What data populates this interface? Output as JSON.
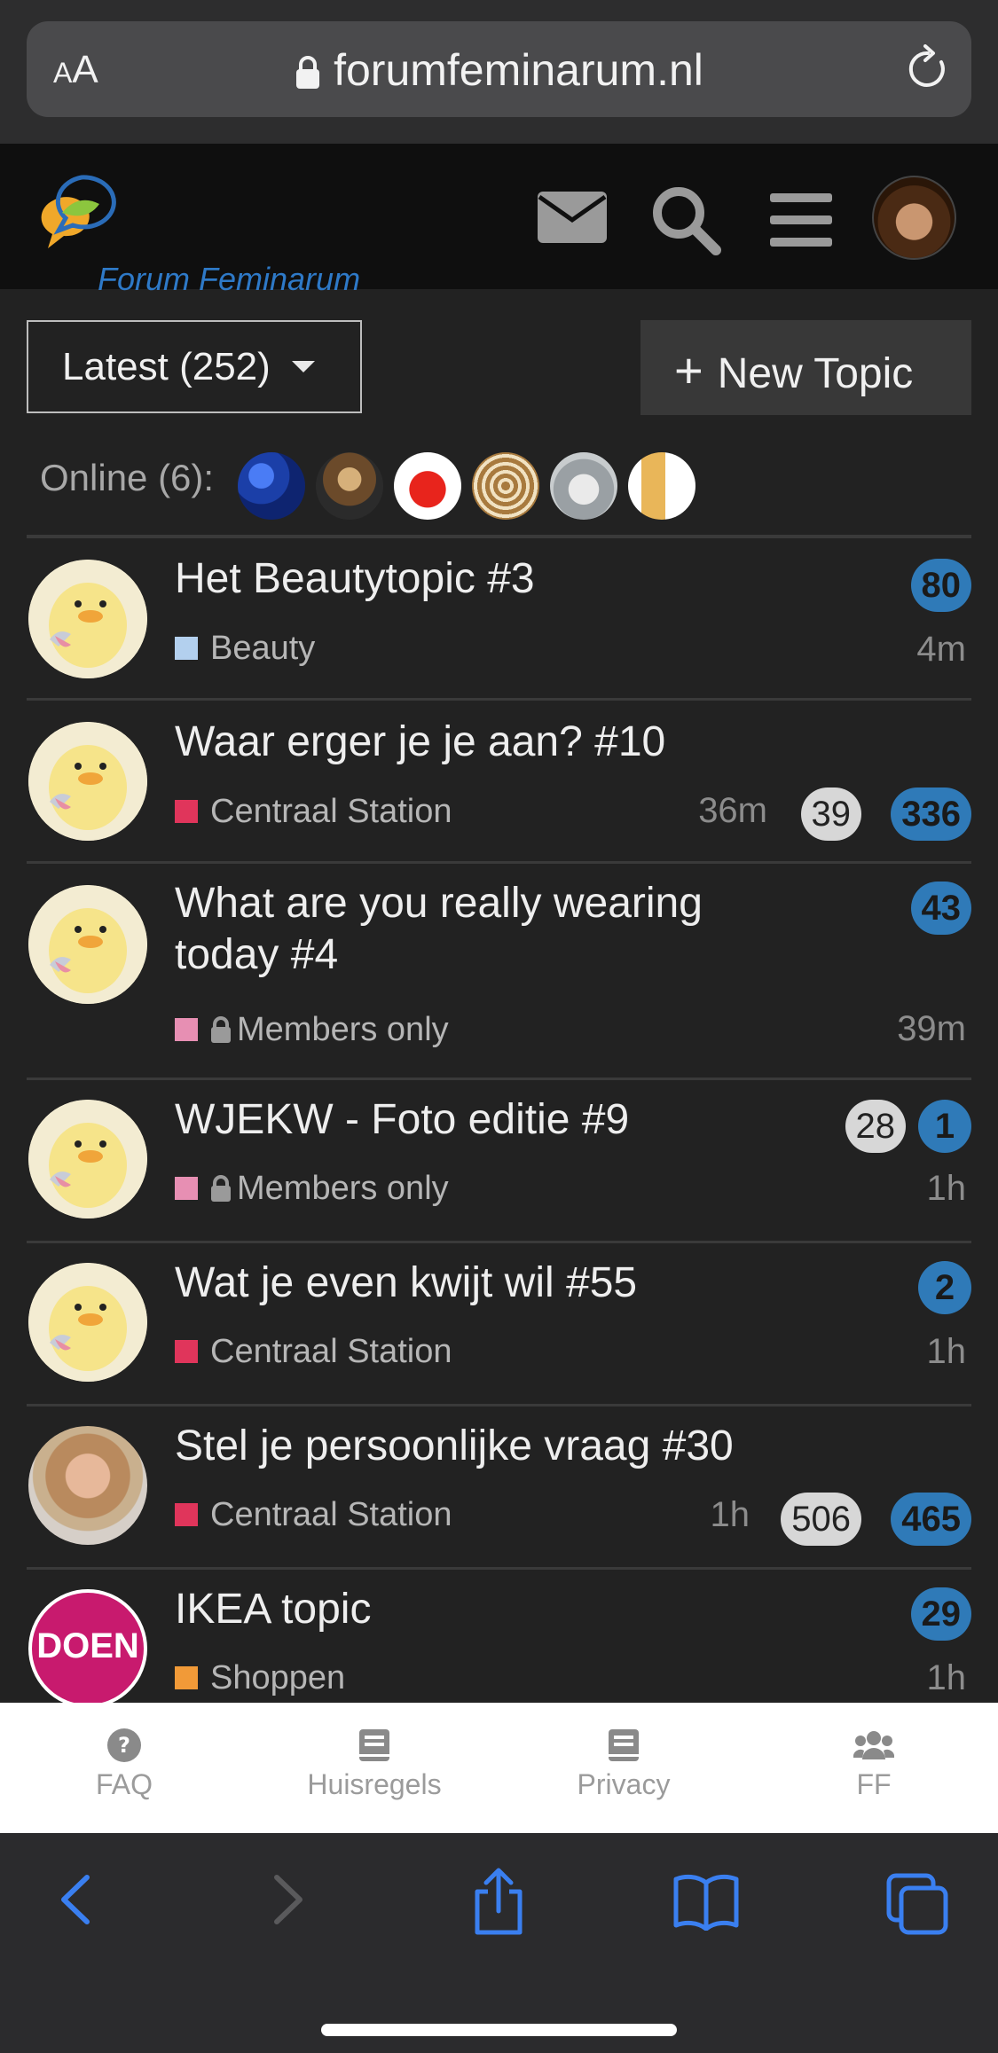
{
  "browser": {
    "text_size_label_small": "A",
    "text_size_label_large": "A",
    "url": "forumfeminarum.nl"
  },
  "header": {
    "logo_text": "Forum Feminarum"
  },
  "controls": {
    "latest_label": "Latest (252)",
    "new_topic_label": "New Topic",
    "new_topic_plus": "+"
  },
  "online": {
    "label": "Online (6):"
  },
  "topics": [
    {
      "title": "Het Beautytopic #3",
      "category": "Beauty",
      "category_color": "#b3d0ee",
      "locked": false,
      "time": "4m",
      "replies": "",
      "unread": "80"
    },
    {
      "title": "Waar erger je je aan? #10",
      "category": "Centraal Station",
      "category_color": "#e0355b",
      "locked": false,
      "time": "36m",
      "replies": "39",
      "unread": "336"
    },
    {
      "title_line1": "What are you really wearing",
      "title_line2": "today #4",
      "category": "Members only",
      "category_color": "#e78fb3",
      "locked": true,
      "time": "39m",
      "replies": "",
      "unread": "43"
    },
    {
      "title": "WJEKW - Foto editie #9",
      "category": "Members only",
      "category_color": "#e78fb3",
      "locked": true,
      "time": "1h",
      "replies": "28",
      "unread": "1"
    },
    {
      "title": "Wat je even kwijt wil #55",
      "category": "Centraal Station",
      "category_color": "#e0355b",
      "locked": false,
      "time": "1h",
      "replies": "",
      "unread": "2"
    },
    {
      "title": "Stel je persoonlijke vraag #30",
      "category": "Centraal Station",
      "category_color": "#e0355b",
      "locked": false,
      "time": "1h",
      "replies": "506",
      "unread": "465"
    },
    {
      "title": "IKEA topic",
      "category": "Shoppen",
      "category_color": "#f19a38",
      "locked": false,
      "time": "1h",
      "replies": "",
      "unread": "29",
      "avatar_text": "DOEN"
    }
  ],
  "footer_nav": [
    {
      "label": "FAQ",
      "icon": "question-circle-icon"
    },
    {
      "label": "Huisregels",
      "icon": "book-icon"
    },
    {
      "label": "Privacy",
      "icon": "book-icon"
    },
    {
      "label": "FF",
      "icon": "users-icon"
    }
  ],
  "colors": {
    "accent_blue": "#2f7ab8",
    "background": "#222222",
    "safari_blue": "#3a7ff0"
  }
}
